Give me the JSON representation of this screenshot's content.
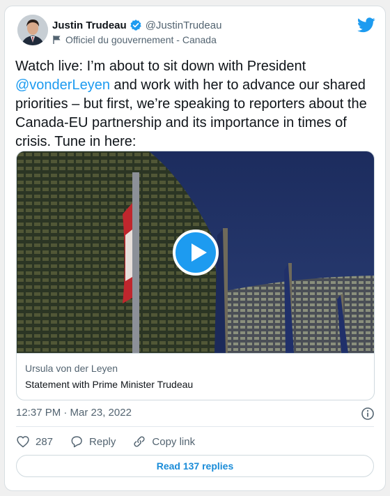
{
  "tweet": {
    "author": {
      "name": "Justin Trudeau",
      "handle": "@JustinTrudeau",
      "affiliation": "Officiel du gouvernement - Canada",
      "verified": true
    },
    "text_before": "Watch live: I’m about to sit down with President ",
    "mention": "@vonderLeyen",
    "text_after": " and work with her to advance our shared priorities – but first, we’re speaking to reporters about the Canada-EU partnership and its importance in times of crisis. Tune in here:",
    "media": {
      "source": "Ursula von der Leyen",
      "title": "Statement with Prime Minister Trudeau"
    },
    "timestamp": "12:37 PM · Mar 23, 2022",
    "actions": {
      "likes": "287",
      "reply_label": "Reply",
      "copy_label": "Copy link"
    },
    "read_replies": "Read 137 replies"
  },
  "colors": {
    "accent": "#1d9bf0",
    "text": "#0f1419",
    "secondary": "#536471"
  },
  "icons": [
    "avatar",
    "verified-badge-icon",
    "flag-icon",
    "twitter-bird-icon",
    "play-icon",
    "info-icon",
    "heart-icon",
    "reply-icon",
    "link-icon"
  ]
}
